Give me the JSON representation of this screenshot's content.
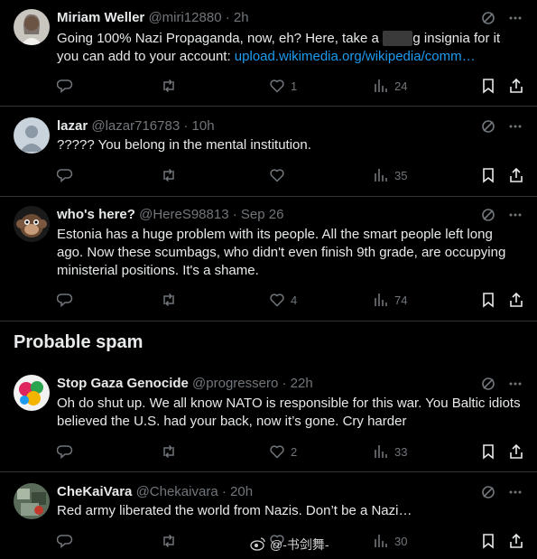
{
  "tweets": [
    {
      "name": "Miriam Weller",
      "handle": "@miri12880",
      "time": "· 2h",
      "text_before": "Going 100% Nazi Propaganda, now, eh? Here, take a ",
      "text_hidden": "        ",
      "text_after": "g insignia for it you can add to your account: ",
      "link": "upload.wikimedia.org/wikipedia/comm…",
      "replies": "",
      "reposts": "",
      "likes": "1",
      "views": "24"
    },
    {
      "name": "lazar",
      "handle": "@lazar716783",
      "time": "· 10h",
      "text": "????? You belong in the mental institution.",
      "replies": "",
      "reposts": "",
      "likes": "",
      "views": "35"
    },
    {
      "name": "who's here?",
      "handle": "@HereS98813",
      "time": "· Sep 26",
      "text": "Estonia has a huge problem with its people. All the smart people left long ago. Now these scumbags, who didn't even finish 9th grade, are occupying ministerial positions. It's a shame.",
      "replies": "",
      "reposts": "",
      "likes": "4",
      "views": "74"
    },
    {
      "name": "Stop Gaza Genocide",
      "handle": "@progressero",
      "time": "· 22h",
      "text": "Oh do shut up. We all know NATO is responsible for this war. You Baltic idiots believed the U.S. had your back, now it’s gone. Cry harder",
      "replies": "",
      "reposts": "",
      "likes": "2",
      "views": "33"
    },
    {
      "name": "CheKaiVara",
      "handle": "@Chekaivara",
      "time": "· 20h",
      "text": "Red army liberated the world from Nazis. Don’t be a Nazi…",
      "replies": "",
      "reposts": "",
      "likes": "",
      "views": "30"
    }
  ],
  "section": {
    "title": "Probable spam"
  },
  "watermark": {
    "text": "@-书剑舞-"
  },
  "icons": {
    "reply": "reply-icon",
    "repost": "repost-icon",
    "like": "heart-icon",
    "views": "views-icon",
    "bookmark": "bookmark-icon",
    "share": "share-icon",
    "grok": "grok-icon",
    "more": "more-icon"
  },
  "colors": {
    "background": "#000000",
    "text": "#e7e9ea",
    "muted": "#71767b",
    "link": "#1d9bf0",
    "divider": "#2f3336"
  }
}
